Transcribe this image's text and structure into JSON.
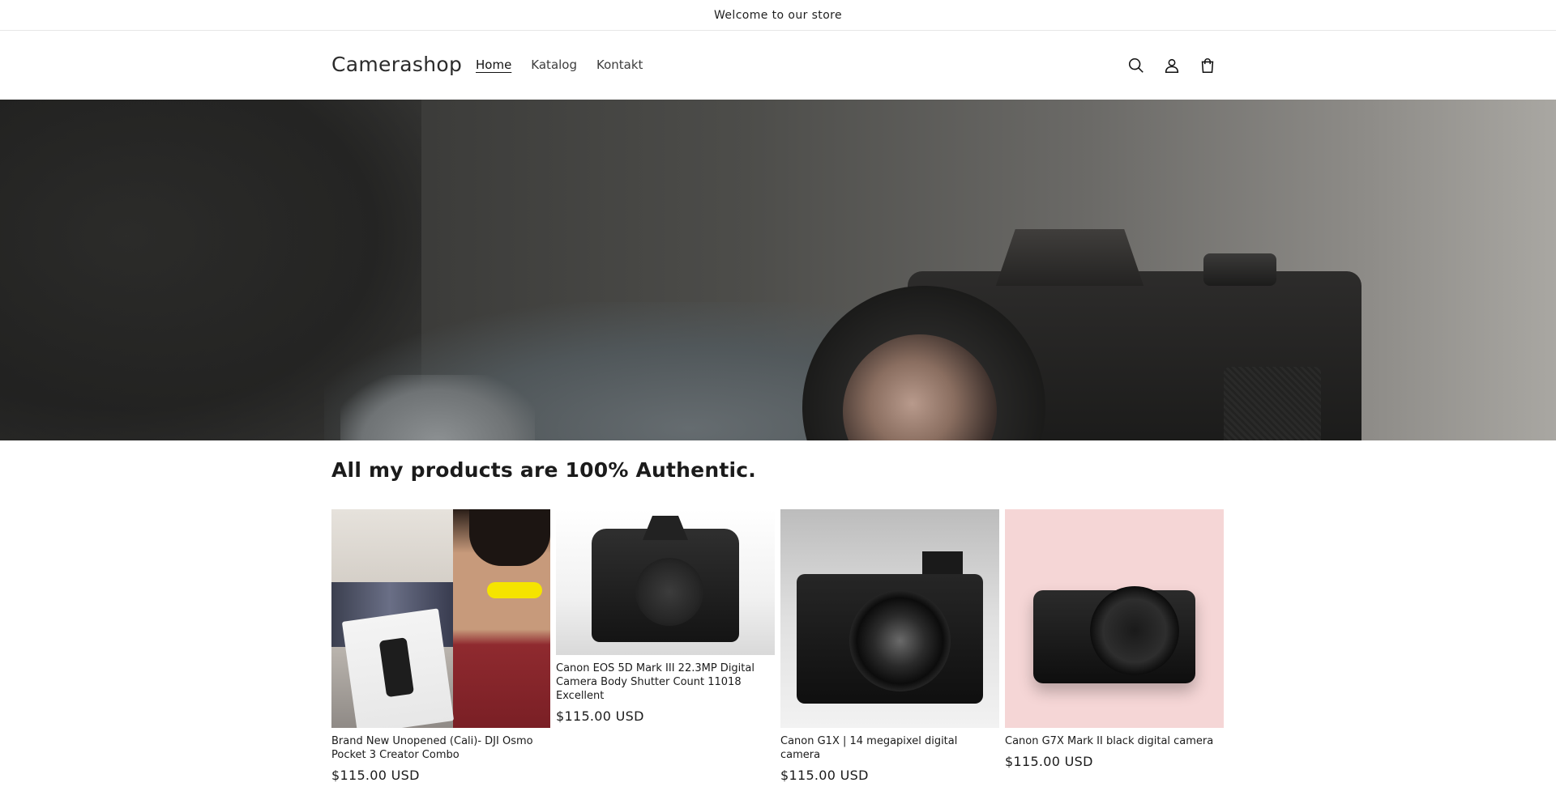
{
  "announcement": {
    "text": "Welcome to our store"
  },
  "header": {
    "brand": "Camerashop",
    "nav": [
      {
        "label": "Home",
        "active": true
      },
      {
        "label": "Katalog",
        "active": false
      },
      {
        "label": "Kontakt",
        "active": false
      }
    ],
    "icons": [
      "search-icon",
      "account-icon",
      "cart-icon"
    ]
  },
  "hero": {
    "image": "blurred-camera-hero"
  },
  "collection": {
    "heading": "All my products are 100% Authentic.",
    "products": [
      {
        "title": "Brand New Unopened (Cali)- DJI Osmo Pocket 3 Creator Combo",
        "price": "$115.00 USD",
        "image": "dji-osmo-pocket-photo"
      },
      {
        "title": "Canon EOS 5D Mark III 22.3MP Digital Camera Body Shutter Count 11018 Excellent",
        "price": "$115.00 USD",
        "image": "canon-5d-photo"
      },
      {
        "title": "Canon G1X | 14 megapixel digital camera",
        "price": "$115.00 USD",
        "image": "canon-g1x-photo"
      },
      {
        "title": "Canon G7X Mark II black digital camera",
        "price": "$115.00 USD",
        "image": "canon-g7x-photo"
      }
    ]
  },
  "colors": {
    "text": "#121212",
    "background": "#ffffff",
    "divider": "#e6e6e6"
  }
}
